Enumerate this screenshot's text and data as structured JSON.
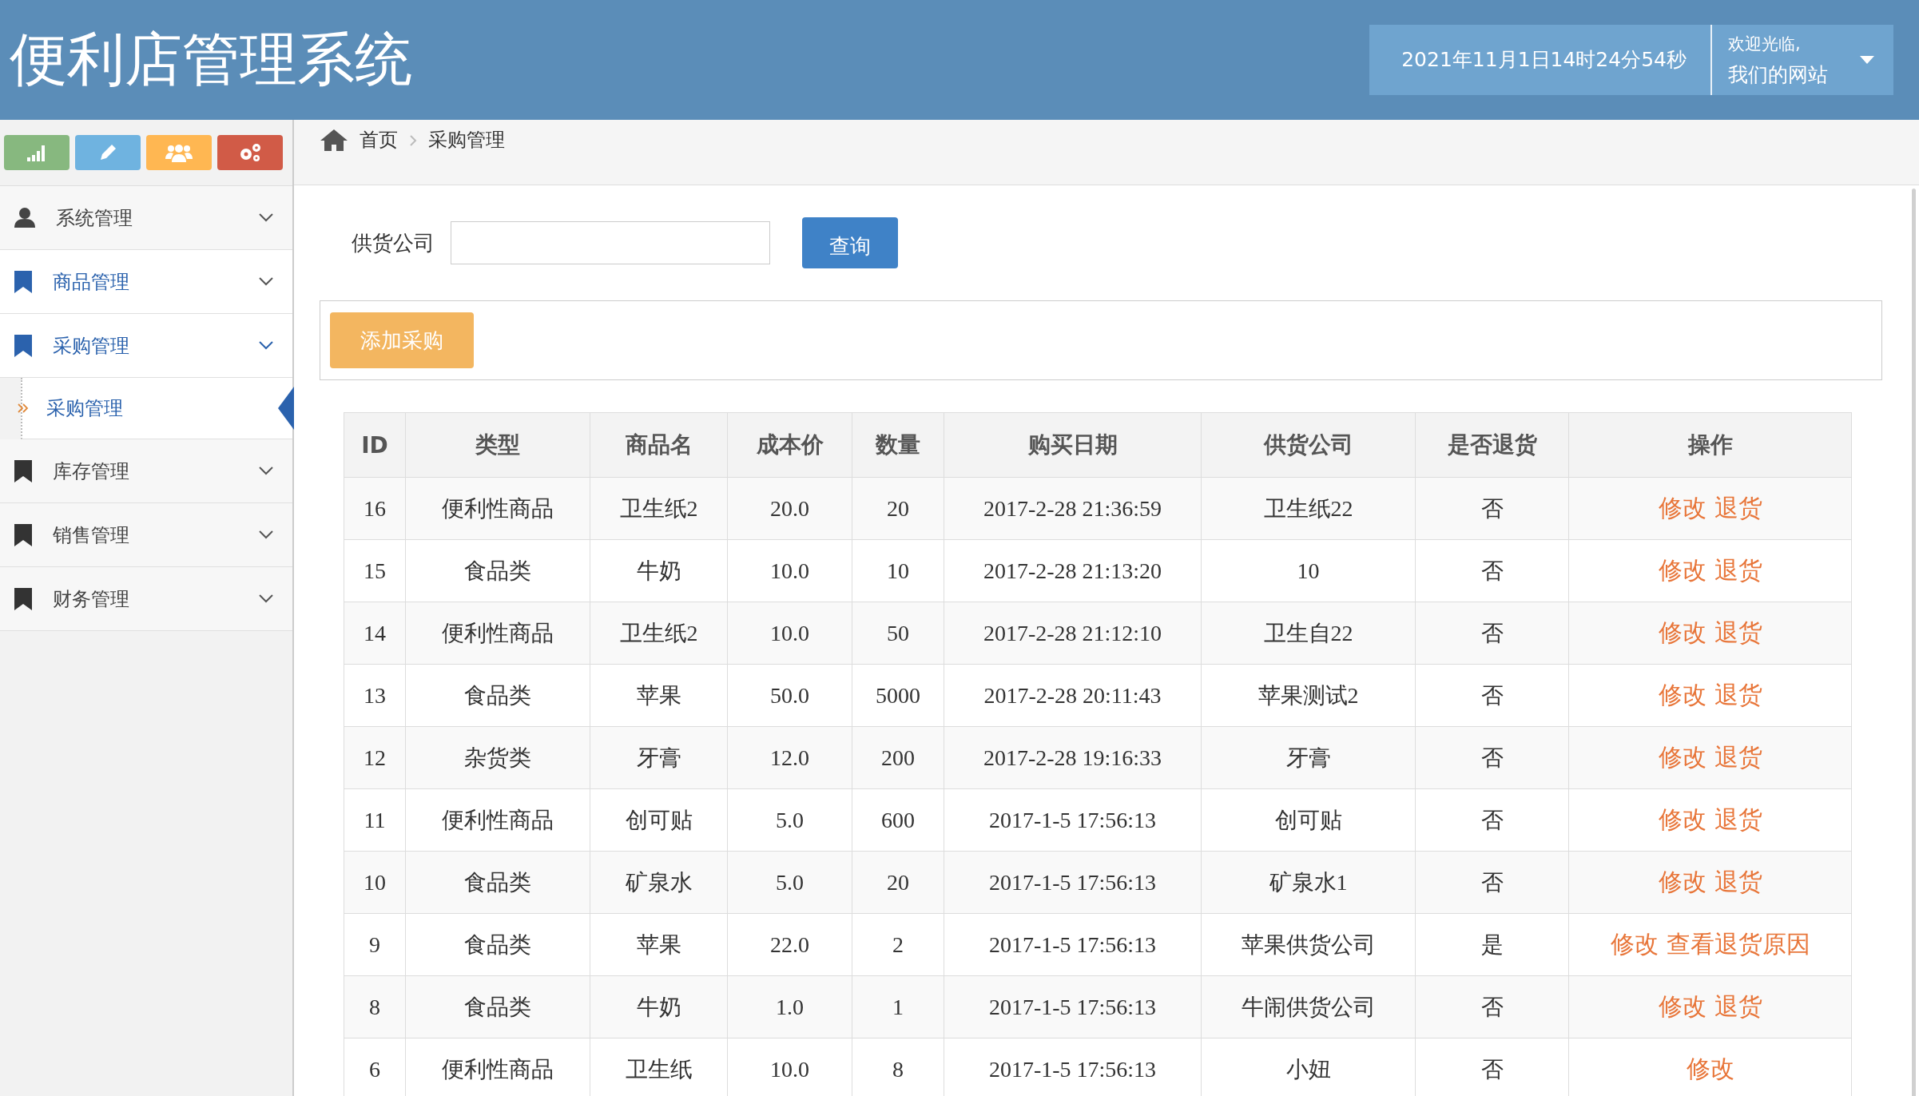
{
  "header": {
    "title": "便利店管理系统",
    "datetime": "2021年11月1日14时24分54秒",
    "welcome": [
      "欢迎光临,",
      "我们的网站"
    ]
  },
  "sidebar": {
    "menu": [
      {
        "label": "系统管理",
        "kind": "account",
        "highlighted": false,
        "expanded": false
      },
      {
        "label": "商品管理",
        "kind": "module",
        "highlighted": true,
        "expanded": false
      },
      {
        "label": "采购管理",
        "kind": "module",
        "highlighted": true,
        "expanded": true,
        "children": [
          {
            "label": "采购管理",
            "selected": true
          }
        ]
      },
      {
        "label": "库存管理",
        "kind": "module",
        "highlighted": false,
        "expanded": false
      },
      {
        "label": "销售管理",
        "kind": "module",
        "highlighted": false,
        "expanded": false
      },
      {
        "label": "财务管理",
        "kind": "module",
        "highlighted": false,
        "expanded": false
      }
    ]
  },
  "breadcrumb": [
    "首页",
    "采购管理"
  ],
  "search": {
    "label": "供货公司",
    "button": "查询"
  },
  "add_button": "添加采购",
  "table": {
    "columns": [
      "ID",
      "类型",
      "商品名",
      "成本价",
      "数量",
      "购买日期",
      "供货公司",
      "是否退货",
      "操作"
    ],
    "rows": [
      {
        "cells": [
          "16",
          "便利性商品",
          "卫生纸2",
          "20.0",
          "20",
          "2017-2-28 21:36:59",
          "卫生纸22",
          "否"
        ],
        "actions": [
          "修改",
          "退货"
        ]
      },
      {
        "cells": [
          "15",
          "食品类",
          "牛奶",
          "10.0",
          "10",
          "2017-2-28 21:13:20",
          "10",
          "否"
        ],
        "actions": [
          "修改",
          "退货"
        ]
      },
      {
        "cells": [
          "14",
          "便利性商品",
          "卫生纸2",
          "10.0",
          "50",
          "2017-2-28 21:12:10",
          "卫生自22",
          "否"
        ],
        "actions": [
          "修改",
          "退货"
        ]
      },
      {
        "cells": [
          "13",
          "食品类",
          "苹果",
          "50.0",
          "5000",
          "2017-2-28 20:11:43",
          "苹果测试2",
          "否"
        ],
        "actions": [
          "修改",
          "退货"
        ]
      },
      {
        "cells": [
          "12",
          "杂货类",
          "牙膏",
          "12.0",
          "200",
          "2017-2-28 19:16:33",
          "牙膏",
          "否"
        ],
        "actions": [
          "修改",
          "退货"
        ]
      },
      {
        "cells": [
          "11",
          "便利性商品",
          "创可贴",
          "5.0",
          "600",
          "2017-1-5 17:56:13",
          "创可贴",
          "否"
        ],
        "actions": [
          "修改",
          "退货"
        ]
      },
      {
        "cells": [
          "10",
          "食品类",
          "矿泉水",
          "5.0",
          "20",
          "2017-1-5 17:56:13",
          "矿泉水1",
          "否"
        ],
        "actions": [
          "修改",
          "退货"
        ]
      },
      {
        "cells": [
          "9",
          "食品类",
          "苹果",
          "22.0",
          "2",
          "2017-1-5 17:56:13",
          "苹果供货公司",
          "是"
        ],
        "actions": [
          "修改",
          "查看退货原因"
        ]
      },
      {
        "cells": [
          "8",
          "食品类",
          "牛奶",
          "1.0",
          "1",
          "2017-1-5 17:56:13",
          "牛闹供货公司",
          "否"
        ],
        "actions": [
          "修改",
          "退货"
        ]
      },
      {
        "cells": [
          "6",
          "便利性商品",
          "卫生纸",
          "10.0",
          "8",
          "2017-1-5 17:56:13",
          "小妞",
          "否"
        ],
        "actions": [
          "修改"
        ]
      }
    ]
  }
}
